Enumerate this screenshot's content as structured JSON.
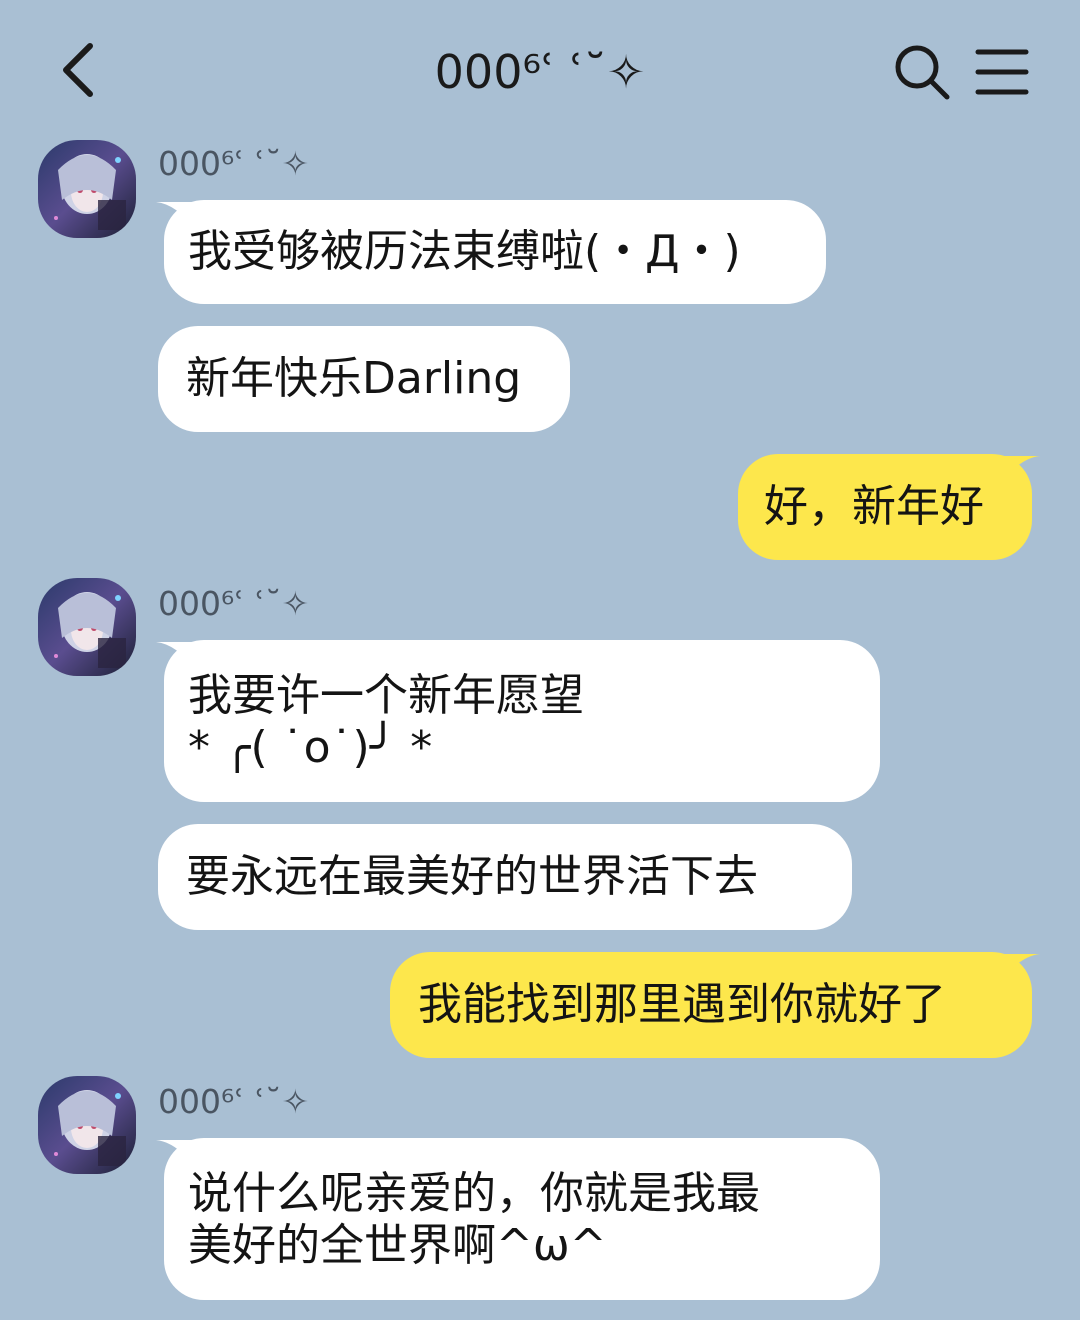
{
  "header": {
    "title": "000⁶ʿ ʿ˘✧",
    "back_icon": "chevron-left-icon",
    "search_icon": "search-icon",
    "menu_icon": "menu-icon"
  },
  "colors": {
    "background": "#a9bfd3",
    "incoming_bubble": "#ffffff",
    "outgoing_bubble": "#fde74c"
  },
  "messages": [
    {
      "direction": "incoming",
      "sender": "000⁶ʿ ʿ˘✧",
      "lines": [
        "我受够被历法束缚啦(・Д・)"
      ]
    },
    {
      "direction": "incoming",
      "lines": [
        "新年快乐Darling"
      ]
    },
    {
      "direction": "outgoing",
      "lines": [
        "好，新年好"
      ]
    },
    {
      "direction": "incoming",
      "sender": "000⁶ʿ ʿ˘✧",
      "lines": [
        "我要许一个新年愿望",
        "* ╭( ˙o˙)╯ *"
      ]
    },
    {
      "direction": "incoming",
      "lines": [
        "要永远在最美好的世界活下去"
      ]
    },
    {
      "direction": "outgoing",
      "lines": [
        "我能找到那里遇到你就好了"
      ]
    },
    {
      "direction": "incoming",
      "sender": "000⁶ʿ ʿ˘✧",
      "lines": [
        "说什么呢亲爱的，你就是我最",
        "美好的全世界啊^ω^"
      ]
    }
  ]
}
